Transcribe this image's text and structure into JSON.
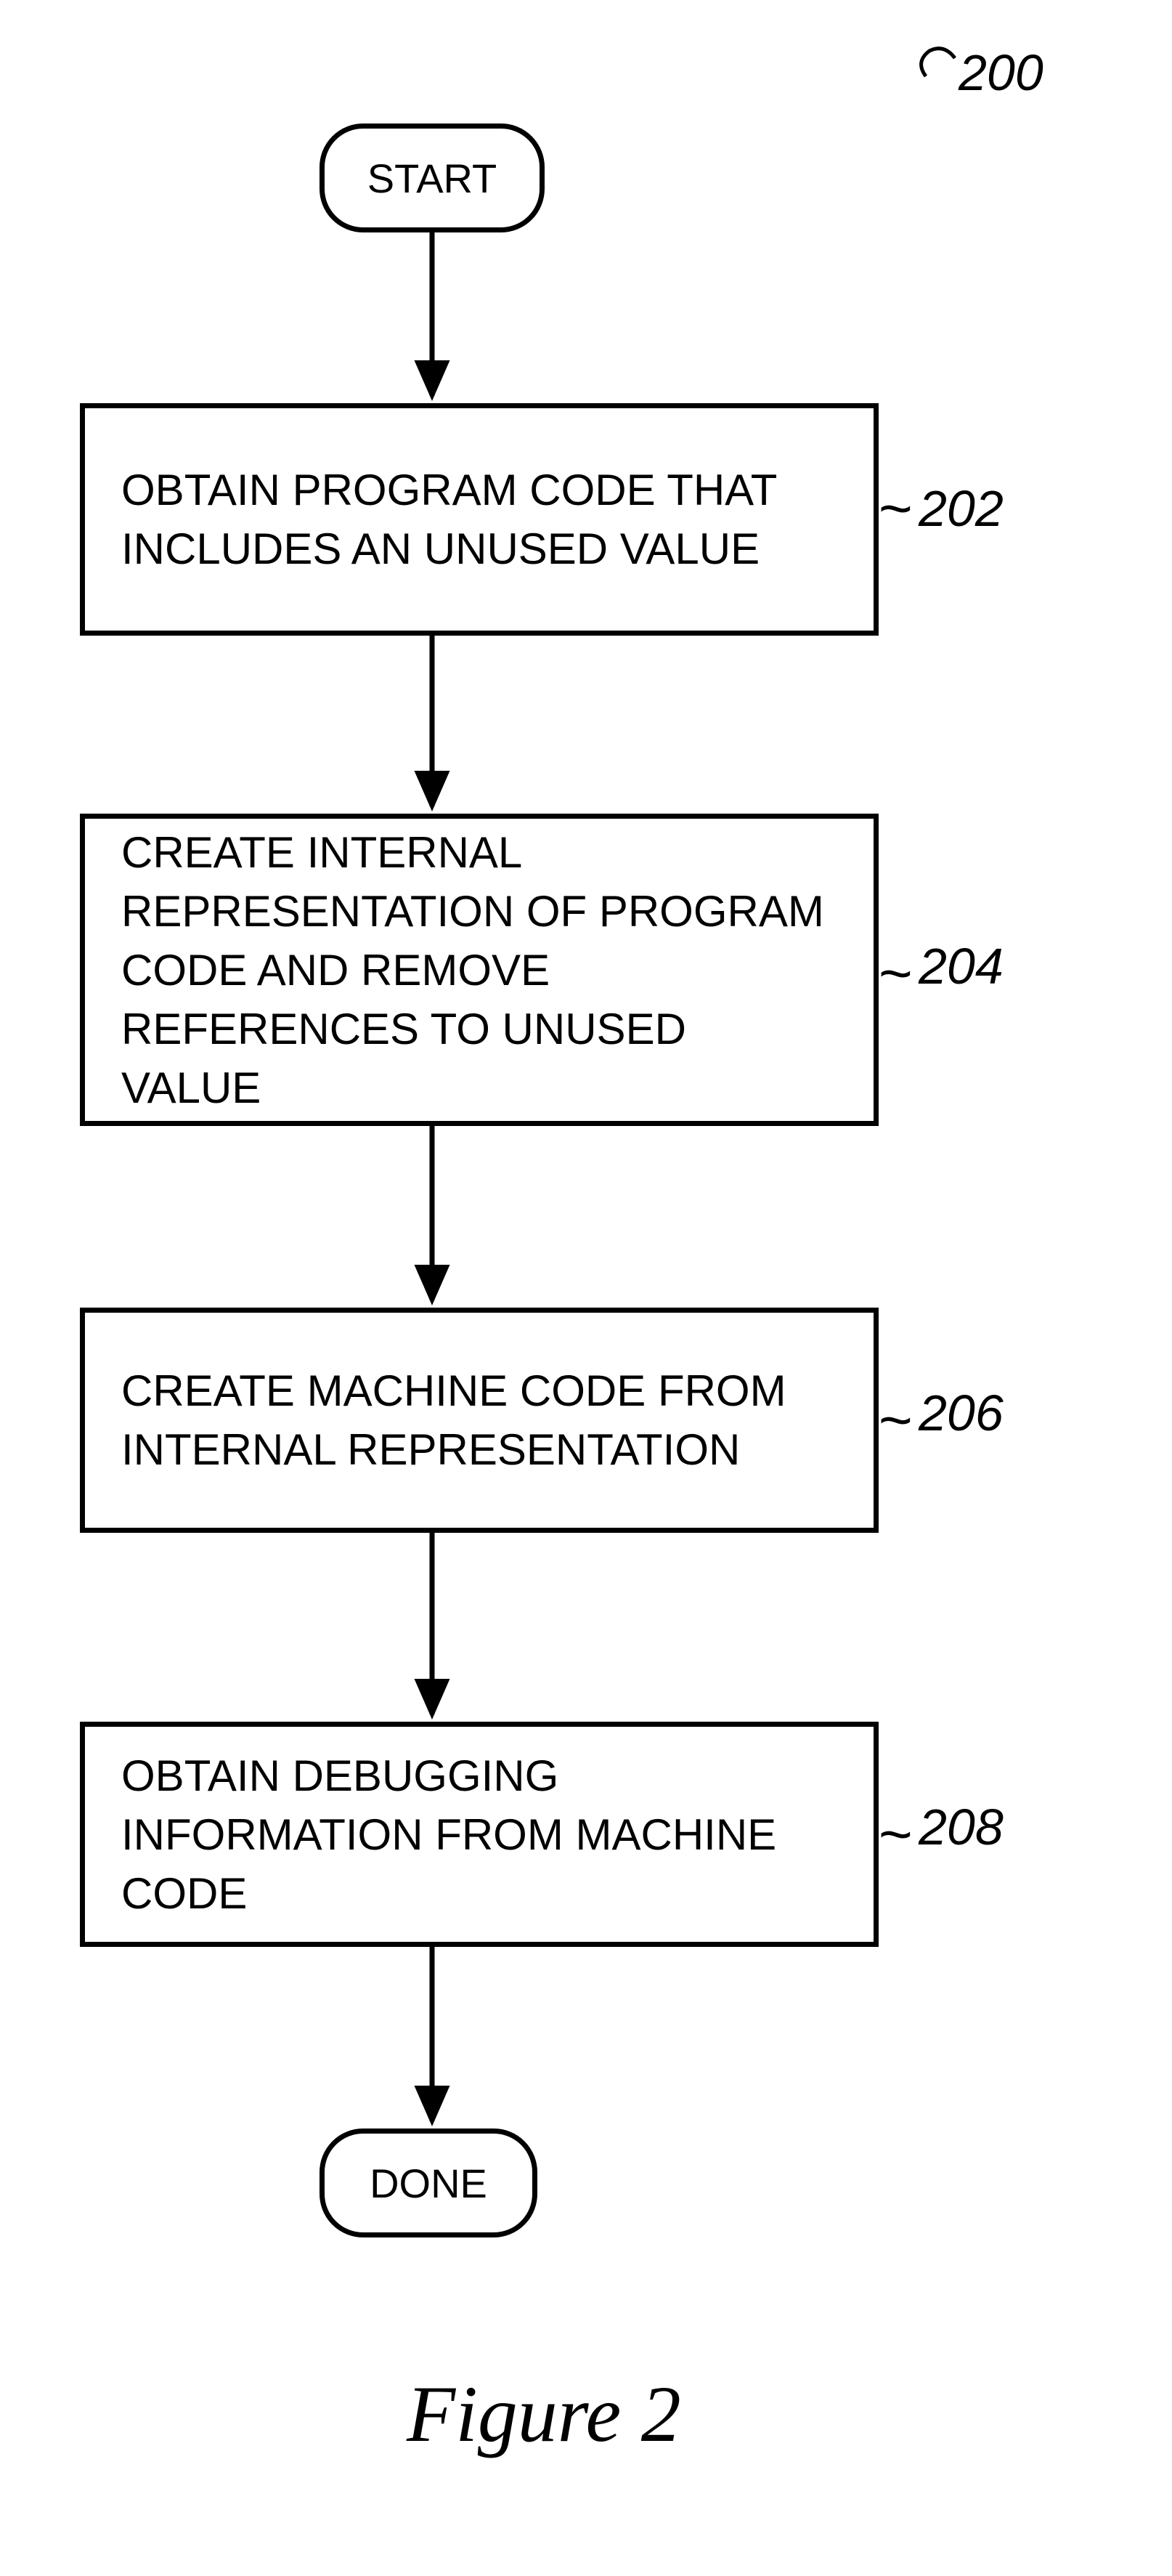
{
  "figure_ref": "200",
  "nodes": {
    "start": {
      "label": "START"
    },
    "step1": {
      "label": "OBTAIN PROGRAM CODE THAT INCLUDES AN UNUSED VALUE",
      "ref": "202"
    },
    "step2": {
      "label": "CREATE INTERNAL REPRESENTATION OF PROGRAM CODE AND REMOVE REFERENCES TO UNUSED VALUE",
      "ref": "204"
    },
    "step3": {
      "label": "CREATE MACHINE CODE FROM INTERNAL REPRESENTATION",
      "ref": "206"
    },
    "step4": {
      "label": "OBTAIN DEBUGGING INFORMATION FROM MACHINE CODE",
      "ref": "208"
    },
    "done": {
      "label": "DONE"
    }
  },
  "caption": "Figure 2"
}
